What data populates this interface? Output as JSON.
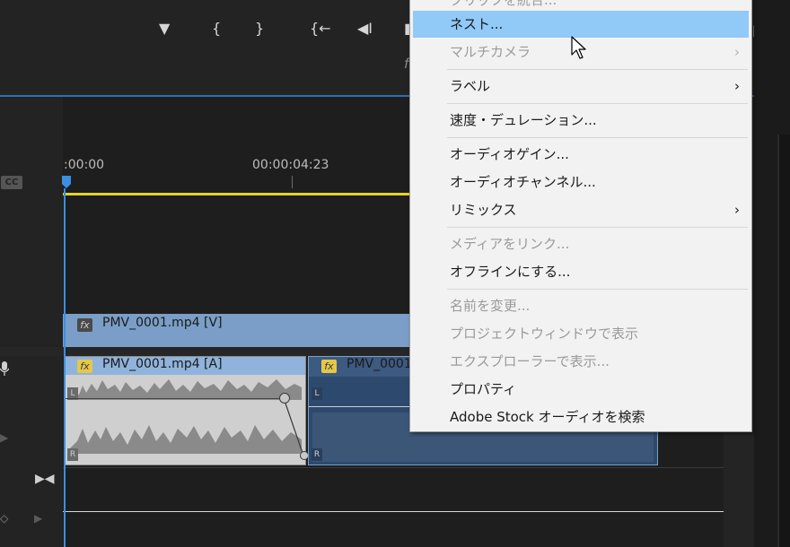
{
  "toolbar": {
    "buttons": [
      "marker",
      "mark-in",
      "mark-out",
      "go-to-in",
      "step-back",
      "play"
    ]
  },
  "timeline": {
    "ruler_start": ":00:00",
    "ruler_mid": "00:00:04:23",
    "cc_badge": "CC",
    "video_clip": {
      "fx": "fx",
      "label": "PMV_0001.mp4 [V]"
    },
    "audio_clip_1": {
      "fx": "fx",
      "label": "PMV_0001.mp4 [A]",
      "left_channel": "L",
      "right_channel": "R"
    },
    "audio_clip_2": {
      "fx": "fx",
      "label": "PMV_0001",
      "left_channel": "L",
      "right_channel": "R"
    },
    "partial_text": "f"
  },
  "context_menu": {
    "top_partial": "クリップを統合...",
    "items": [
      {
        "label": "ネスト...",
        "state": "highlighted"
      },
      {
        "label": "マルチカメラ",
        "state": "disabled",
        "submenu": true
      },
      {
        "label": "ラベル",
        "state": "enabled",
        "submenu": true
      },
      {
        "label": "速度・デュレーション...",
        "state": "enabled"
      },
      {
        "label": "オーディオゲイン...",
        "state": "enabled"
      },
      {
        "label": "オーディオチャンネル...",
        "state": "enabled"
      },
      {
        "label": "リミックス",
        "state": "enabled",
        "submenu": true
      },
      {
        "label": "メディアをリンク...",
        "state": "disabled"
      },
      {
        "label": "オフラインにする...",
        "state": "enabled"
      },
      {
        "label": "名前を変更...",
        "state": "disabled"
      },
      {
        "label": "プロジェクトウィンドウで表示",
        "state": "disabled"
      },
      {
        "label": "エクスプローラーで表示...",
        "state": "disabled"
      },
      {
        "label": "プロパティ",
        "state": "enabled"
      },
      {
        "label": "Adobe Stock オーディオを検索",
        "state": "enabled"
      }
    ],
    "submenu_arrow": "›"
  },
  "colors": {
    "menu_highlight": "#91c9f7",
    "playhead": "#3b8fe0",
    "work_area": "#e6d51e",
    "video_clip": "#7a9ec7",
    "audio_clip_selected": "#cfcfcf",
    "audio_clip_2": "#2d4a6e"
  }
}
